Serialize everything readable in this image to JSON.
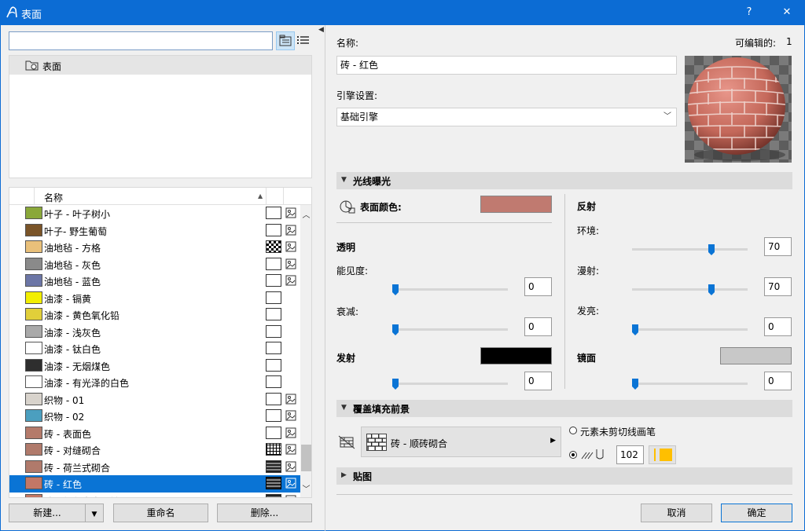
{
  "window": {
    "title": "表面",
    "help": "?",
    "close": "✕"
  },
  "left": {
    "search": {
      "value": "",
      "placeholder": ""
    },
    "tree": {
      "root_label": "表面"
    },
    "list_header": {
      "name": "名称"
    },
    "items": [
      {
        "name": "叶子 - 叶子树小",
        "color": "#8aa83a",
        "tex": true,
        "pattern": "none"
      },
      {
        "name": "叶子- 野生葡萄",
        "color": "#7a5428",
        "tex": true,
        "pattern": "none"
      },
      {
        "name": "油地毡 - 方格",
        "color": "#e9c07a",
        "tex": true,
        "pattern": "checker"
      },
      {
        "name": "油地毡 - 灰色",
        "color": "#8a8a8a",
        "tex": true,
        "pattern": "none"
      },
      {
        "name": "油地毡 - 蓝色",
        "color": "#6c76a6",
        "tex": true,
        "pattern": "none"
      },
      {
        "name": "油漆 - 镉黄",
        "color": "#f2ee00",
        "tex": false,
        "pattern": "none"
      },
      {
        "name": "油漆 - 黄色氧化铅",
        "color": "#e1cf3a",
        "tex": false,
        "pattern": "none"
      },
      {
        "name": "油漆 - 浅灰色",
        "color": "#a9a9a9",
        "tex": false,
        "pattern": "none"
      },
      {
        "name": "油漆 - 钛白色",
        "color": "#ffffff",
        "tex": false,
        "pattern": "none"
      },
      {
        "name": "油漆 - 无烟煤色",
        "color": "#2e2e2e",
        "tex": false,
        "pattern": "none"
      },
      {
        "name": "油漆 - 有光泽的白色",
        "color": "#ffffff",
        "tex": false,
        "pattern": "none"
      },
      {
        "name": "织物 - 01",
        "color": "#d8d3cc",
        "tex": true,
        "pattern": "none"
      },
      {
        "name": "织物 - 02",
        "color": "#4b9fbf",
        "tex": true,
        "pattern": "none"
      },
      {
        "name": "砖 - 表面色",
        "color": "#b47a6a",
        "tex": true,
        "pattern": "none"
      },
      {
        "name": "砖 - 对缝砌合",
        "color": "#b07a6b",
        "tex": true,
        "pattern": "grid"
      },
      {
        "name": "砖 - 荷兰式砌合",
        "color": "#b07a6b",
        "tex": true,
        "pattern": "brick"
      },
      {
        "name": "砖 - 红色",
        "color": "#c27766",
        "tex": true,
        "pattern": "brick",
        "selected": true
      },
      {
        "name": "砖 - 红色大宽砌缝",
        "color": "#c27766",
        "tex": true,
        "pattern": "brick"
      }
    ],
    "buttons": {
      "new": "新建...",
      "rename": "重命名",
      "delete": "删除..."
    }
  },
  "right": {
    "name_label": "名称:",
    "editable_label": "可编辑的:",
    "editable_count": "1",
    "name_value": "砖 - 红色",
    "engine_label": "引擎设置:",
    "engine_value": "基础引擎",
    "section_light": "光线曝光",
    "surface_color_label": "表面颜色:",
    "surface_color": "#c07a70",
    "transparency_title": "透明",
    "visibility_label": "能见度:",
    "visibility_value": "0",
    "attenuation_label": "衰减:",
    "attenuation_value": "0",
    "emission_label": "发射",
    "emission_color": "#000000",
    "emission_value": "0",
    "reflection_title": "反射",
    "ambient_label": "环境:",
    "ambient_value": "70",
    "diffuse_label": "漫射:",
    "diffuse_value": "70",
    "shine_label": "发亮:",
    "shine_value": "0",
    "specular_label": "镜面",
    "specular_color": "#c8c8c8",
    "specular_value": "0",
    "section_fill": "覆盖填充前景",
    "fill_name": "砖 - 顺砖砌合",
    "radio_uncut_label": "元素未剪切线画笔",
    "pen_number": "102",
    "pen_color": "#ffbf00",
    "section_texture": "贴图",
    "cancel": "取消",
    "ok": "确定"
  },
  "levels": {
    "visibility": 0,
    "attenuation": 0,
    "emission": 0,
    "ambient": 70,
    "diffuse": 70,
    "shine": 0,
    "specular": 0
  }
}
